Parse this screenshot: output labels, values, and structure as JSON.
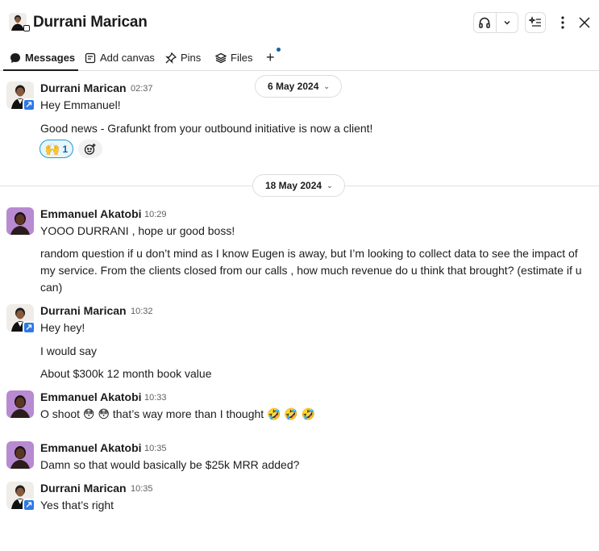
{
  "header": {
    "title": "Durrani Marican",
    "icons": [
      "headphones-icon",
      "chevron-down-icon",
      "ai-sparkle-icon",
      "more-vertical-icon",
      "close-icon"
    ]
  },
  "tabs": [
    {
      "label": "Messages",
      "icon": "message-bubble-icon",
      "active": true
    },
    {
      "label": "Add canvas",
      "icon": "canvas-icon"
    },
    {
      "label": "Pins",
      "icon": "pin-icon"
    },
    {
      "label": "Files",
      "icon": "layers-icon"
    },
    {
      "label": "+",
      "icon": "plus-icon"
    }
  ],
  "dates": [
    "6 May 2024",
    "18 May 2024"
  ],
  "messages": [
    {
      "sender": "Durrani Marican",
      "time": "02:37",
      "lines": [
        "Hey Emmanuel!",
        "Good news - Grafunkt from your outbound initiative is now a client!"
      ],
      "reaction": {
        "emoji": "🙌",
        "count": "1"
      }
    },
    {
      "sender": "Emmanuel Akatobi",
      "time": "10:29",
      "lines": [
        "YOOO DURRANI , hope ur good boss!",
        "random question if u don’t mind as I know Eugen is away, but I’m looking to collect data to see the impact of my service. From the clients closed from our calls , how much revenue do u think that brought? (estimate if u can)"
      ]
    },
    {
      "sender": "Durrani Marican",
      "time": "10:32",
      "lines": [
        "Hey hey!",
        "I would say",
        "About $300k 12 month book value"
      ]
    },
    {
      "sender": "Emmanuel Akatobi",
      "time": "10:33",
      "lines": [
        "O shoot 😳 😳 that’s way more than I thought 🤣 🤣 🤣"
      ]
    },
    {
      "sender": "Emmanuel Akatobi",
      "time": "10:35",
      "lines": [
        "Damn so that would basically be $25k MRR added?"
      ]
    },
    {
      "sender": "Durrani Marican",
      "time": "10:35",
      "lines": [
        "Yes that’s right"
      ]
    }
  ],
  "colors": {
    "accent": "#1264a3",
    "verified": "#2e79e6",
    "reaction_border": "#1d9bd1"
  }
}
